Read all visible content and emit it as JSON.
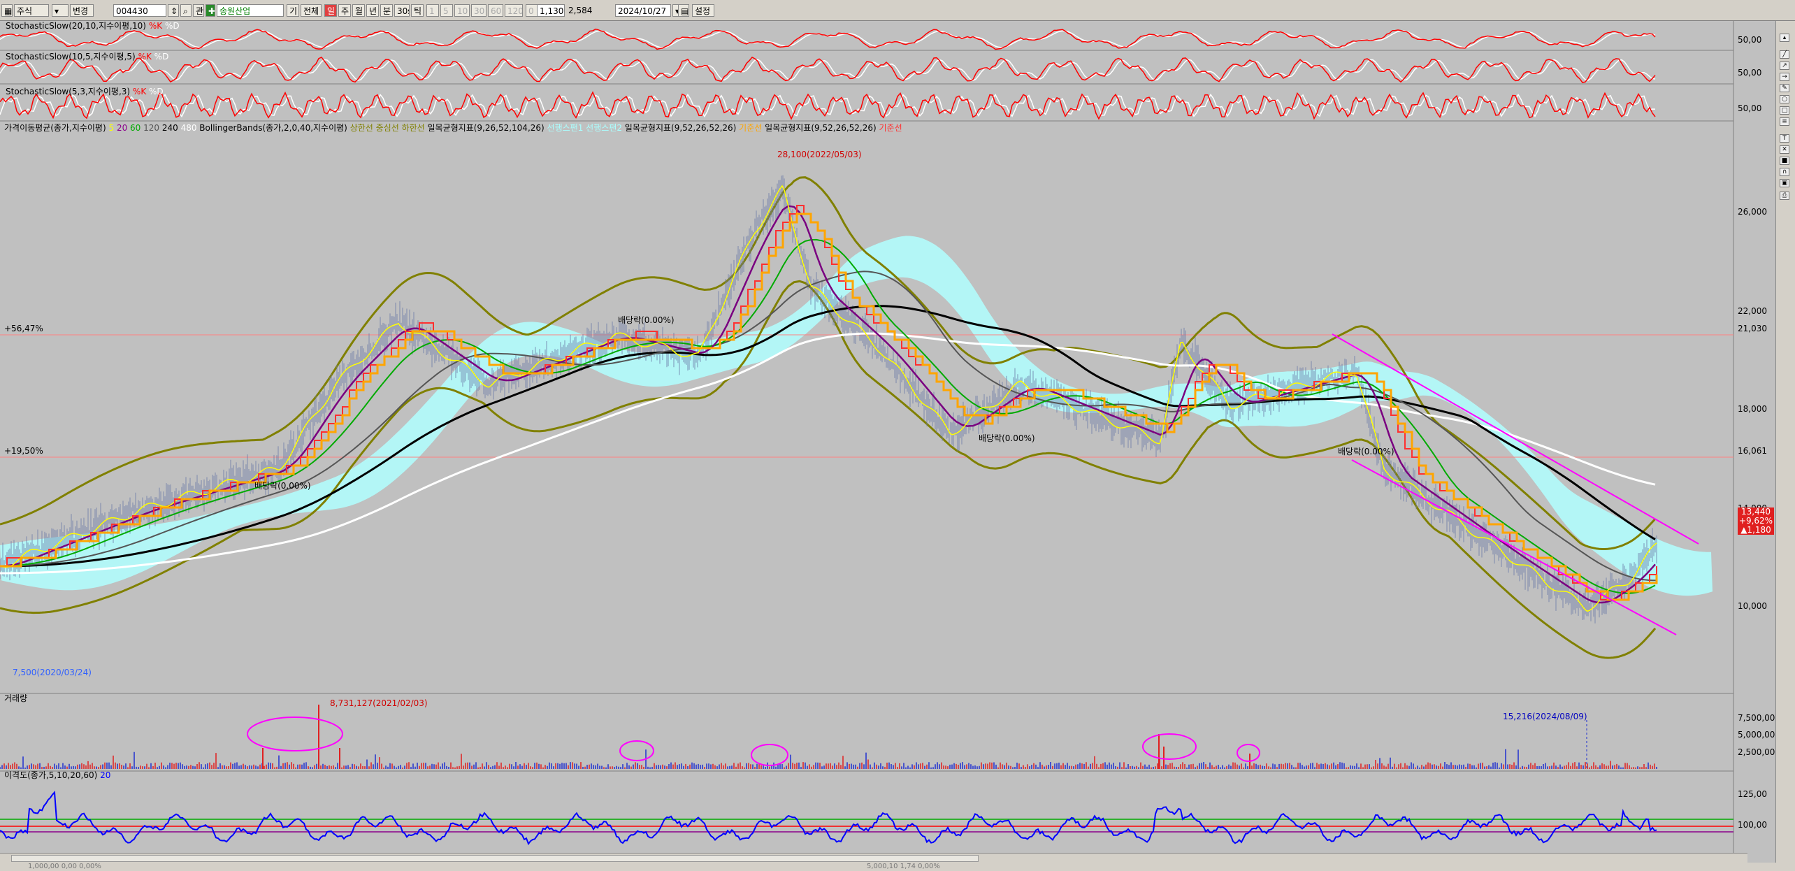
{
  "toolbar": {
    "market": "주식",
    "change": "변경",
    "code": "004430",
    "name": "송원산업",
    "period": "기",
    "all": "전체",
    "mode_day": "일",
    "intervals": [
      "주",
      "월",
      "년",
      "분",
      "30s",
      "틱"
    ],
    "minute_options": [
      "1",
      "5",
      "10",
      "30",
      "60",
      "120",
      "0",
      "1"
    ],
    "count": "1,130",
    "total": "2,584",
    "date": "2024/10/27",
    "settings": "설정"
  },
  "panes": {
    "stoch1": {
      "title": "StochasticSlow(20,10,지수이평,10)",
      "k": "%K",
      "d": "%D",
      "axis": "50,00"
    },
    "stoch2": {
      "title": "StochasticSlow(10,5,지수이평,5)",
      "k": "%K",
      "d": "%D",
      "axis": "50,00"
    },
    "stoch3": {
      "title": "StochasticSlow(5,3,지수이평,3)",
      "k": "%K",
      "d": "%D",
      "axis": "50,00"
    },
    "price": {
      "legend": [
        {
          "text": "가격이동평균(종가,지수이평)",
          "color": "#000000"
        },
        {
          "text": "5",
          "color": "#ffff00"
        },
        {
          "text": "20",
          "color": "#8b008b"
        },
        {
          "text": "60",
          "color": "#00aa00"
        },
        {
          "text": "120",
          "color": "#555555"
        },
        {
          "text": "240",
          "color": "#000000"
        },
        {
          "text": "480",
          "color": "#ffffff"
        },
        {
          "text": "BollingerBands(종가,2,0,40,지수이평)",
          "color": "#000000"
        },
        {
          "text": "상한선",
          "color": "#808000"
        },
        {
          "text": "중심선",
          "color": "#808000"
        },
        {
          "text": "하한선",
          "color": "#808000"
        },
        {
          "text": "일목균형지표(9,26,52,104,26)",
          "color": "#000000"
        },
        {
          "text": "선행스팬1",
          "color": "#aaffff"
        },
        {
          "text": "선행스팬2",
          "color": "#aaffff"
        },
        {
          "text": "일목균형지표(9,52,26,52,26)",
          "color": "#000000"
        },
        {
          "text": "기준선",
          "color": "#ffa500"
        },
        {
          "text": "일목균형지표(9,52,26,52,26)",
          "color": "#000000"
        },
        {
          "text": "기준선",
          "color": "#ff3030"
        }
      ],
      "axis_labels": [
        "26,000",
        "22,000",
        "18,000",
        "14,000",
        "10,000"
      ],
      "hline_top_left": "+56,47%",
      "hline_top_right": "21,030",
      "hline_mid_left": "+19,50%",
      "hline_mid_right": "16,061",
      "max_label": "28,100(2022/05/03)",
      "min_label": "7,500(2020/03/24)",
      "dividend_labels": [
        "배당락(0.00%)",
        "배당락(0.00%)",
        "배당락(0.00%)",
        "배당락(0.00%)"
      ],
      "price_tag": [
        "13,440",
        "+9,62%",
        "▲1,180"
      ]
    },
    "volume": {
      "title": "거래량",
      "max_label": "8,731,127(2021/02/03)",
      "recent_label": "15,216(2024/08/09)",
      "axis_labels": [
        "7,500,000",
        "5,000,000",
        "2,500,000"
      ]
    },
    "disparity": {
      "title": "이격도(종가,5,10,20,60)",
      "period": "20",
      "axis_labels": [
        "125,00",
        "100,00"
      ]
    }
  },
  "status": {
    "left": "1,000,00   0,00  0,00%",
    "right": "5,000,10   1,74  0,00%"
  },
  "colors": {
    "bg": "#c0c0c0",
    "bb": "#808000",
    "ma5": "#ffff00",
    "ma20": "#7a0080",
    "ma60": "#00aa00",
    "ma120": "#555555",
    "ma240": "#000000",
    "ma480": "#ffffff",
    "cloud": "#b0ffff",
    "kijun": "#ffa500",
    "kijun2": "#ff3030",
    "channel": "#ff00ff",
    "stoch": "#ff0000",
    "disparity": "#0000ff"
  }
}
